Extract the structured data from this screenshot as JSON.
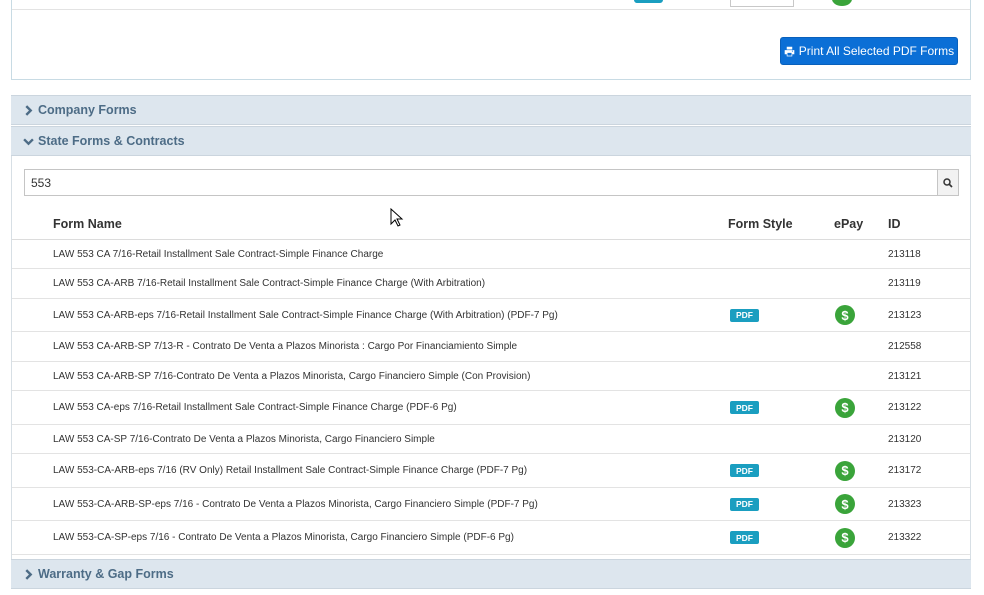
{
  "print_button": {
    "label": "Print All Selected PDF Forms"
  },
  "sections": {
    "company": "Company Forms",
    "state": "State Forms & Contracts",
    "warranty": "Warranty & Gap Forms"
  },
  "search": {
    "value": "553"
  },
  "table": {
    "headers": {
      "name": "Form Name",
      "style": "Form Style",
      "epay": "ePay",
      "id": "ID"
    },
    "pdf_label": "PDF",
    "rows": [
      {
        "name": "LAW 553 CA 7/16-Retail Installment Sale Contract-Simple Finance Charge",
        "pdf": false,
        "epay": false,
        "id": "213118"
      },
      {
        "name": "LAW 553 CA-ARB 7/16-Retail Installment Sale Contract-Simple Finance Charge (With Arbitration)",
        "pdf": false,
        "epay": false,
        "id": "213119"
      },
      {
        "name": "LAW 553 CA-ARB-eps 7/16-Retail Installment Sale Contract-Simple Finance Charge (With Arbitration) (PDF-7 Pg)",
        "pdf": true,
        "epay": true,
        "id": "213123"
      },
      {
        "name": "LAW 553 CA-ARB-SP 7/13-R - Contrato De Venta a Plazos Minorista : Cargo Por Financiamiento Simple",
        "pdf": false,
        "epay": false,
        "id": "212558"
      },
      {
        "name": "LAW 553 CA-ARB-SP 7/16-Contrato De Venta a Plazos Minorista, Cargo Financiero Simple (Con Provision)",
        "pdf": false,
        "epay": false,
        "id": "213121"
      },
      {
        "name": "LAW 553 CA-eps 7/16-Retail Installment Sale Contract-Simple Finance Charge (PDF-6 Pg)",
        "pdf": true,
        "epay": true,
        "id": "213122"
      },
      {
        "name": "LAW 553 CA-SP 7/16-Contrato De Venta a Plazos Minorista, Cargo Financiero Simple",
        "pdf": false,
        "epay": false,
        "id": "213120"
      },
      {
        "name": "LAW 553-CA-ARB-eps 7/16 (RV Only) Retail Installment Sale Contract-Simple Finance Charge (PDF-7 Pg)",
        "pdf": true,
        "epay": true,
        "id": "213172"
      },
      {
        "name": "LAW 553-CA-ARB-SP-eps 7/16 - Contrato De Venta a Plazos Minorista, Cargo Financiero Simple (PDF-7 Pg)",
        "pdf": true,
        "epay": true,
        "id": "213323"
      },
      {
        "name": "LAW 553-CA-SP-eps 7/16 - Contrato De Venta a Plazos Minorista, Cargo Financiero Simple (PDF-6 Pg)",
        "pdf": true,
        "epay": true,
        "id": "213322"
      }
    ]
  },
  "colors": {
    "accent_blue": "#0b6fd6",
    "pdf_badge": "#1a9ec0",
    "epay_green": "#3aa43a",
    "section_header_bg": "#dde6ee",
    "section_header_text": "#4d6c86"
  },
  "icons": {
    "print": "print-icon",
    "search": "search-icon",
    "epay": "dollar-icon",
    "collapsed": "chevron-right-icon",
    "expanded": "chevron-down-icon"
  }
}
